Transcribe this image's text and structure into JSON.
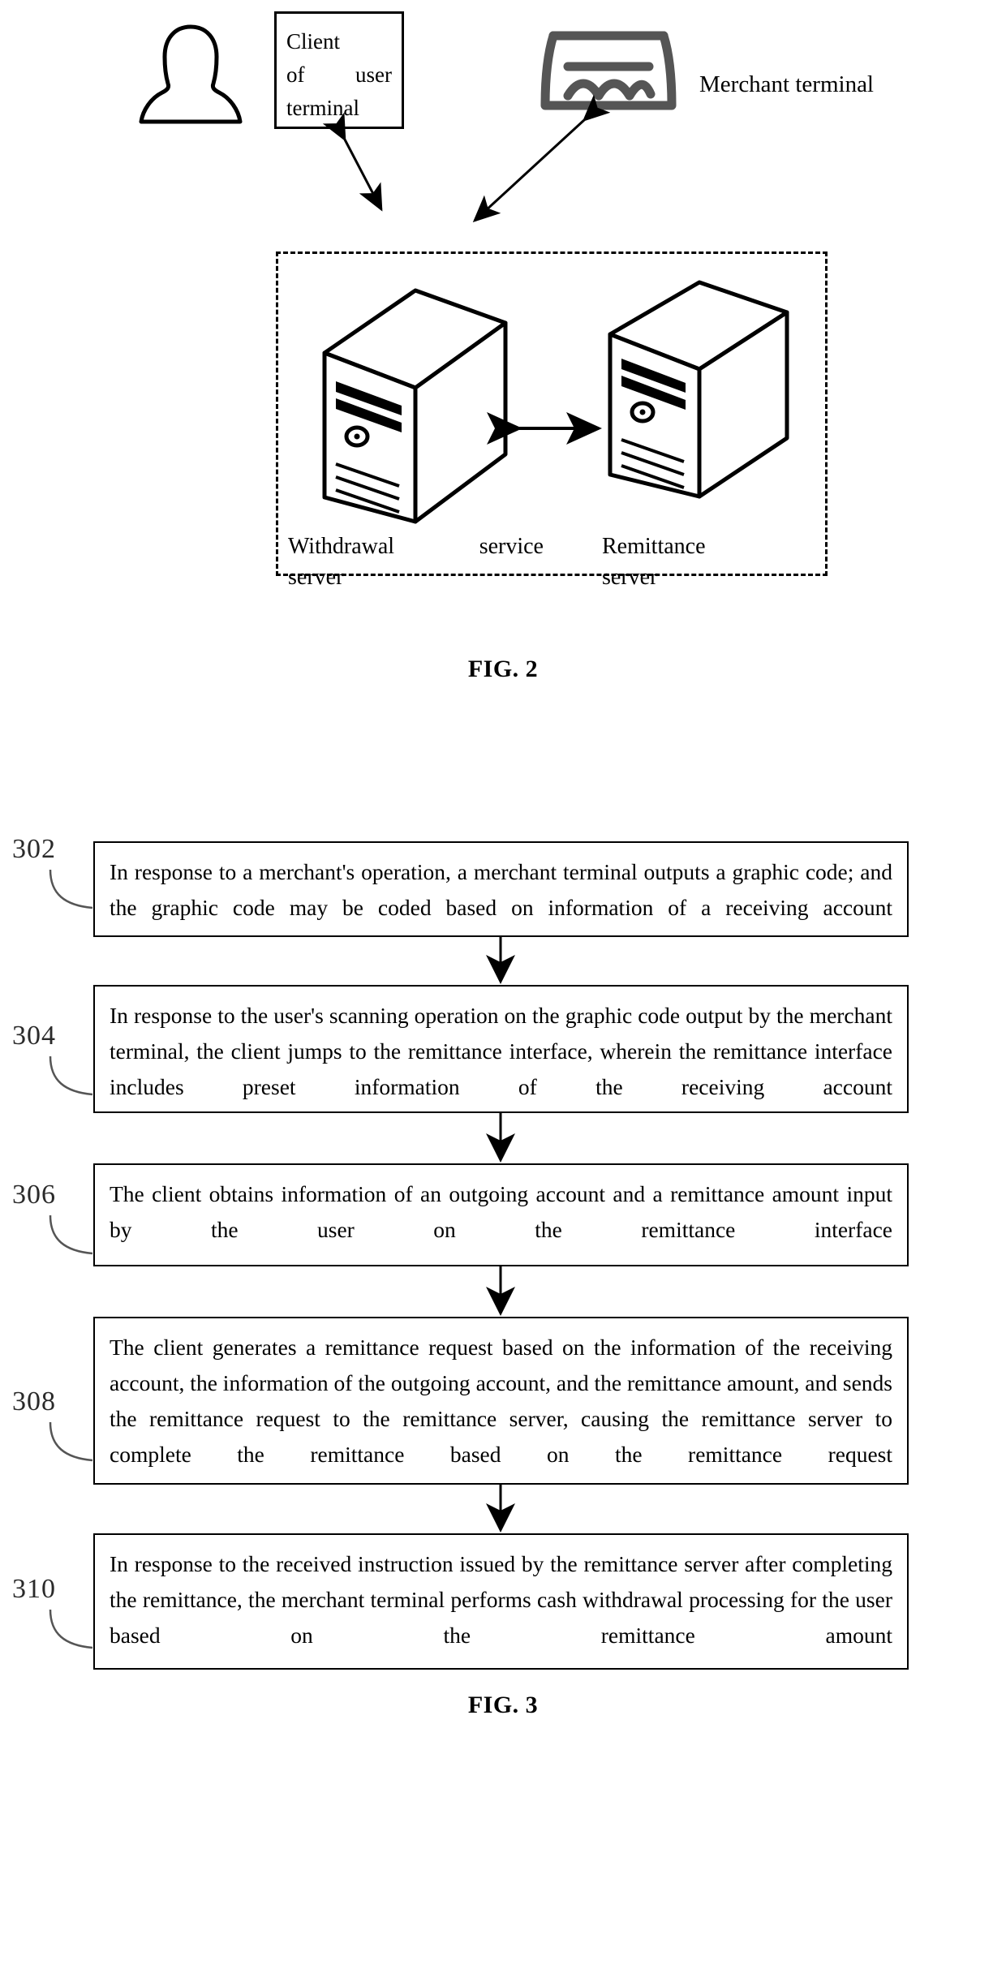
{
  "figure2": {
    "caption": "FIG. 2",
    "client_box": {
      "line1": "Client",
      "line2_a": "of",
      "line2_b": "user",
      "line3": "terminal"
    },
    "person_icon_name": "user-person-icon",
    "merchant_icon_name": "merchant-store-icon",
    "merchant_label": "Merchant terminal",
    "withdrawal_server_label": {
      "line1_a": "Withdrawal",
      "line1_b": "service",
      "line2": "server"
    },
    "remittance_server_label": {
      "line1": "Remittance",
      "line2": "server"
    }
  },
  "figure3": {
    "caption": "FIG. 3",
    "steps": [
      {
        "number": "302",
        "text": "In response to a merchant's operation, a merchant terminal outputs a graphic code; and the graphic code may be coded based on information of a receiving account"
      },
      {
        "number": "304",
        "text": "In response to the user's scanning operation on the graphic code output by the merchant terminal, the client jumps to the remittance interface, wherein the remittance interface includes preset information of the receiving account"
      },
      {
        "number": "306",
        "text": "The client obtains information of an outgoing account and a remittance amount input by the user on the remittance interface"
      },
      {
        "number": "308",
        "text": "The client generates a remittance request based on the information of the receiving account, the information of the outgoing account, and the remittance amount, and sends the remittance request to the remittance server, causing the remittance server to complete the remittance based on the remittance request"
      },
      {
        "number": "310",
        "text": "In response to the received instruction issued by the remittance server after completing the remittance, the merchant terminal performs cash withdrawal processing for the user based on the remittance amount"
      }
    ]
  },
  "colors": {
    "ink": "#000000",
    "paper": "#ffffff"
  }
}
